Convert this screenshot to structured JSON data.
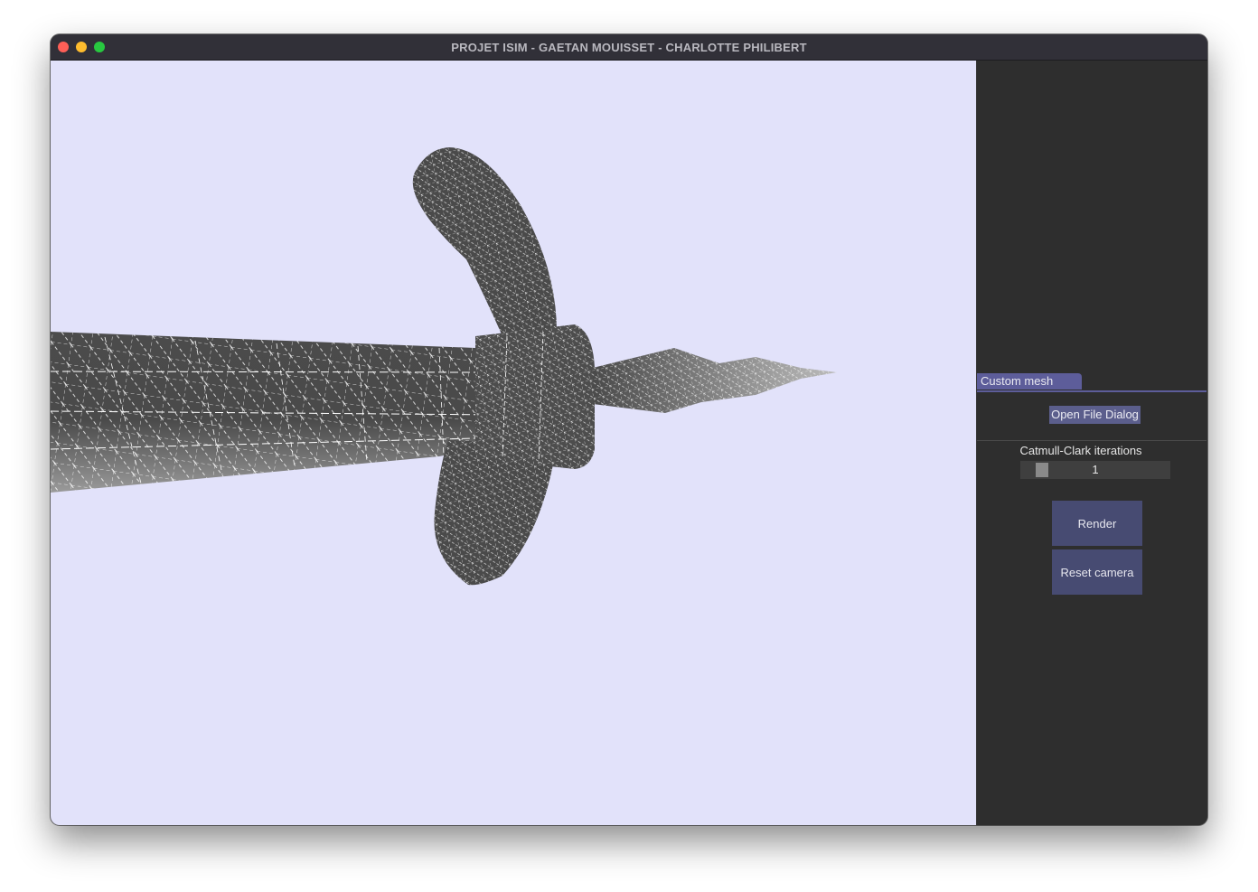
{
  "window": {
    "title": "PROJET ISIM - GAETAN MOUISSET - CHARLOTTE PHILIBERT"
  },
  "panel": {
    "tab_label": "Custom mesh",
    "open_file_label": "Open File Dialog",
    "slider": {
      "label": "Catmull-Clark iterations",
      "value": "1"
    },
    "render_label": "Render",
    "reset_camera_label": "Reset camera"
  },
  "colors": {
    "viewport_background": "#e2e2fa",
    "mesh_fill": "#4a4a4a",
    "wireframe": "#ffffff",
    "accent": "#5d5d9a"
  },
  "icons": [
    "close-traffic-light",
    "minimize-traffic-light",
    "maximize-traffic-light"
  ]
}
